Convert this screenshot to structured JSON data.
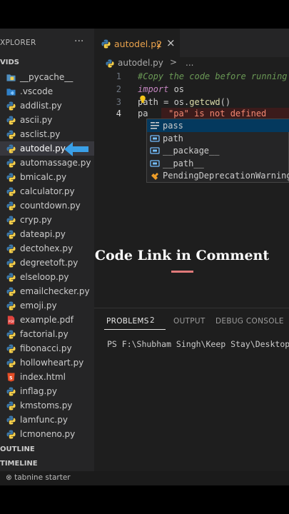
{
  "sidebar": {
    "title": "XPLORER",
    "more": "···",
    "folder": "VIDS",
    "items": [
      {
        "label": "__pycache__",
        "icon": "folder-pycache-icon"
      },
      {
        "label": ".vscode",
        "icon": "folder-vscode-icon"
      },
      {
        "label": "addlist.py",
        "icon": "python-file-icon"
      },
      {
        "label": "ascii.py",
        "icon": "python-file-icon"
      },
      {
        "label": "asclist.py",
        "icon": "python-file-icon"
      },
      {
        "label": "autodel.py",
        "icon": "python-file-icon",
        "selected": true
      },
      {
        "label": "automassage.py",
        "icon": "python-file-icon"
      },
      {
        "label": "bmicalc.py",
        "icon": "python-file-icon"
      },
      {
        "label": "calculator.py",
        "icon": "python-file-icon"
      },
      {
        "label": "countdown.py",
        "icon": "python-file-icon"
      },
      {
        "label": "cryp.py",
        "icon": "python-file-icon"
      },
      {
        "label": "dateapi.py",
        "icon": "python-file-icon"
      },
      {
        "label": "dectohex.py",
        "icon": "python-file-icon"
      },
      {
        "label": "degreetoft.py",
        "icon": "python-file-icon"
      },
      {
        "label": "elseloop.py",
        "icon": "python-file-icon"
      },
      {
        "label": "emailchecker.py",
        "icon": "python-file-icon"
      },
      {
        "label": "emoji.py",
        "icon": "python-file-icon"
      },
      {
        "label": "example.pdf",
        "icon": "pdf-file-icon"
      },
      {
        "label": "factorial.py",
        "icon": "python-file-icon"
      },
      {
        "label": "fibonacci.py",
        "icon": "python-file-icon"
      },
      {
        "label": "hollowheart.py",
        "icon": "python-file-icon"
      },
      {
        "label": "index.html",
        "icon": "html-file-icon"
      },
      {
        "label": "inflag.py",
        "icon": "python-file-icon"
      },
      {
        "label": "kmstoms.py",
        "icon": "python-file-icon"
      },
      {
        "label": "lamfunc.py",
        "icon": "python-file-icon"
      },
      {
        "label": "lcmoneno.py",
        "icon": "python-file-icon"
      }
    ],
    "outline": "OUTLINE",
    "timeline": "TIMELINE"
  },
  "status": {
    "text": "⊗ tabnine starter"
  },
  "tab": {
    "label": "autodel.py",
    "count": "2",
    "close": "×"
  },
  "breadcrumb": {
    "file": "autodel.py",
    "sep": ">",
    "ellipsis": "..."
  },
  "code": {
    "line_numbers": [
      "1",
      "2",
      "3",
      "4"
    ],
    "line1": "#Copy the code before running",
    "line2_kw": "import",
    "line2_rest": " os",
    "line3_a": "path = os.",
    "line3_fn": "getcwd",
    "line3_b": "()",
    "line4": "pa",
    "error": "\"pa\" is not defined"
  },
  "suggestions": [
    {
      "label": "pass",
      "icon": "keyword-icon"
    },
    {
      "label": "path",
      "icon": "variable-icon"
    },
    {
      "label": "__package__",
      "icon": "variable-icon"
    },
    {
      "label": "__path__",
      "icon": "variable-icon"
    },
    {
      "label": "PendingDeprecationWarning",
      "icon": "class-icon"
    }
  ],
  "overlay": {
    "caption": "Code Link in Comment"
  },
  "panel": {
    "tabs": {
      "problems": "PROBLEMS",
      "problems_count": "2",
      "output": "OUTPUT",
      "debug": "DEBUG CONSOLE"
    },
    "terminal": "PS F:\\Shubham Singh\\Keep Stay\\Desktop\\Vi"
  },
  "colors": {
    "accent_arrow": "#3aa0e8",
    "error": "#f48771",
    "tab_modified": "#e9a24c"
  }
}
